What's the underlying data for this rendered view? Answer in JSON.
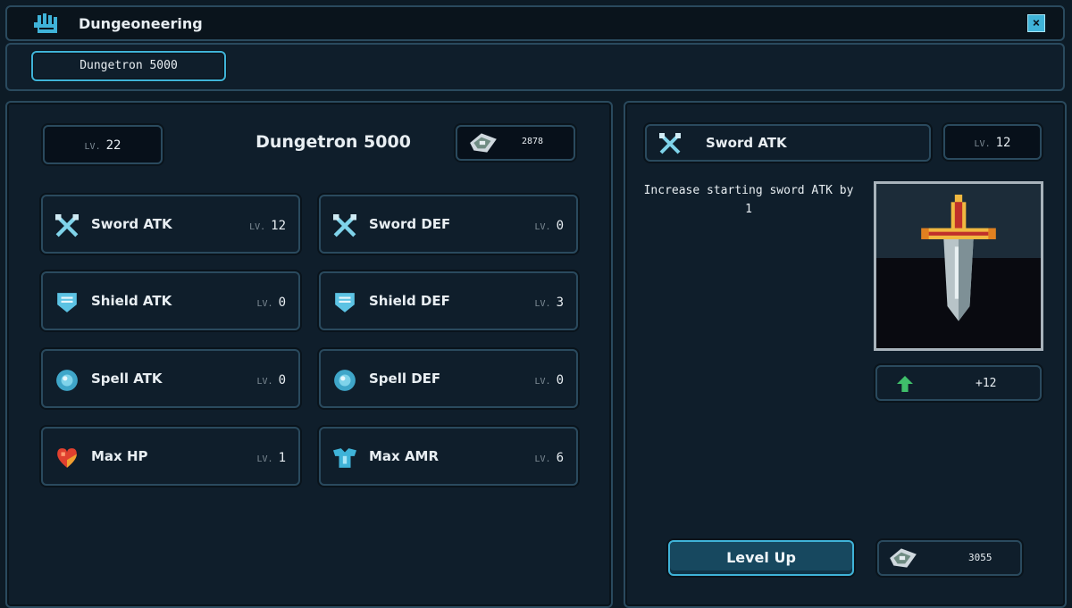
{
  "window": {
    "title": "Dungeoneering",
    "close_label": "×"
  },
  "tabs": [
    {
      "label": "Dungetron 5000"
    }
  ],
  "left": {
    "level_label": "LV.",
    "level_value": "22",
    "name": "Dungetron 5000",
    "currency_value": "2878",
    "skills": [
      {
        "label": "Sword ATK",
        "lv_label": "LV.",
        "lv": "12",
        "icon": "sword-icon"
      },
      {
        "label": "Sword DEF",
        "lv_label": "LV.",
        "lv": "0",
        "icon": "sword-icon"
      },
      {
        "label": "Shield ATK",
        "lv_label": "LV.",
        "lv": "0",
        "icon": "shield-icon"
      },
      {
        "label": "Shield DEF",
        "lv_label": "LV.",
        "lv": "3",
        "icon": "shield-icon"
      },
      {
        "label": "Spell ATK",
        "lv_label": "LV.",
        "lv": "0",
        "icon": "orb-icon"
      },
      {
        "label": "Spell DEF",
        "lv_label": "LV.",
        "lv": "0",
        "icon": "orb-icon"
      },
      {
        "label": "Max HP",
        "lv_label": "LV.",
        "lv": "1",
        "icon": "heart-icon"
      },
      {
        "label": "Max AMR",
        "lv_label": "LV.",
        "lv": "6",
        "icon": "armor-icon"
      }
    ]
  },
  "right": {
    "selected_name": "Sword ATK",
    "selected_lv_label": "LV.",
    "selected_lv": "12",
    "description": "Increase starting sword ATK by 1",
    "bonus_value": "+12",
    "level_up_label": "Level Up",
    "cost_value": "3055"
  },
  "colors": {
    "accent": "#3fb3d8",
    "panel": "#0f1e2b",
    "border": "#2a4a5e"
  }
}
